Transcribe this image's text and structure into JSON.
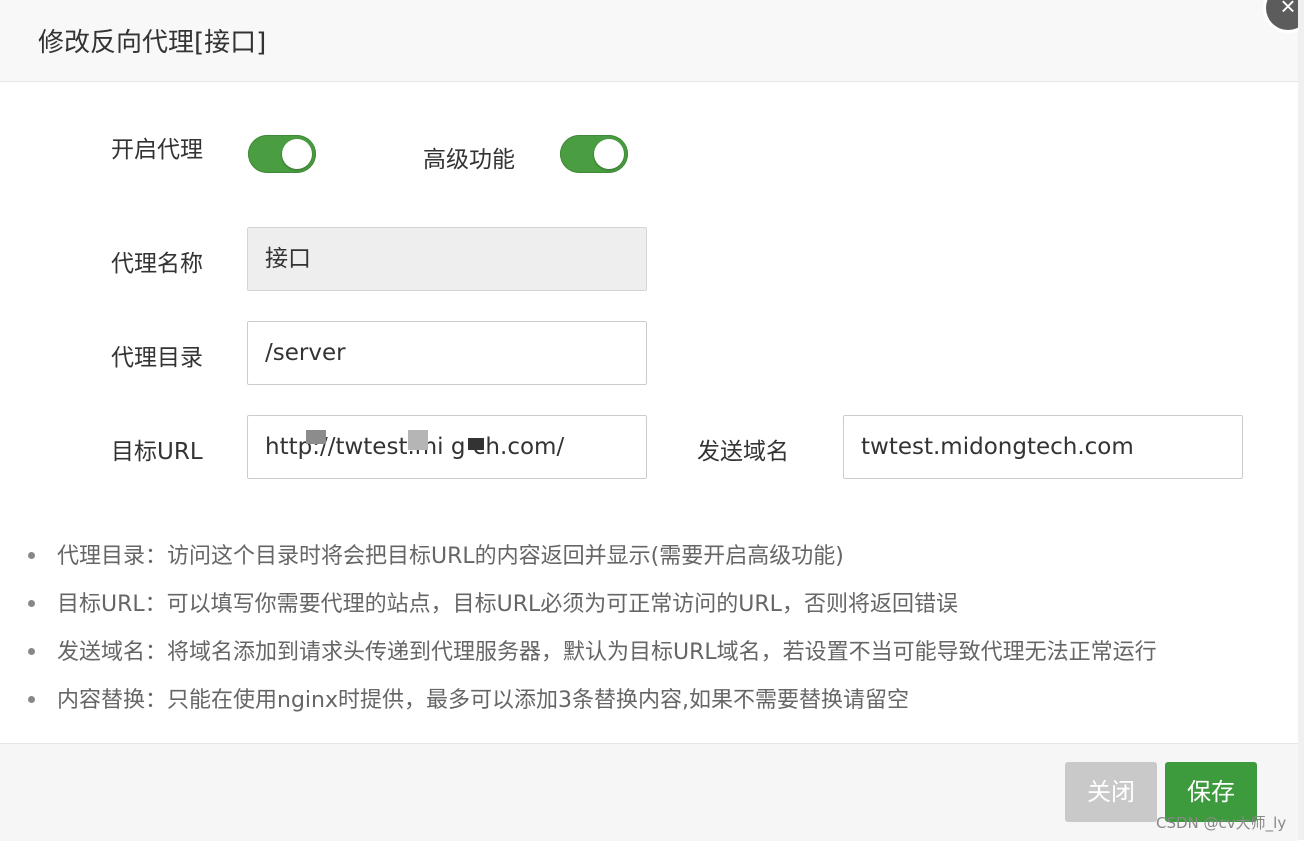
{
  "dialog": {
    "title": "修改反向代理[接口]",
    "close_glyph": "×"
  },
  "form": {
    "enable_proxy": {
      "label": "开启代理",
      "on": true
    },
    "advanced": {
      "label": "高级功能",
      "on": true
    },
    "proxy_name": {
      "label": "代理名称",
      "value": "接口"
    },
    "proxy_dir": {
      "label": "代理目录",
      "value": "/server"
    },
    "target_url": {
      "label": "目标URL",
      "value": "http://twtest.mi  g  ch.com/"
    },
    "send_domain": {
      "label": "发送域名",
      "value": "twtest.midongtech.com"
    }
  },
  "tips": [
    "代理目录：访问这个目录时将会把目标URL的内容返回并显示(需要开启高级功能)",
    "目标URL：可以填写你需要代理的站点，目标URL必须为可正常访问的URL，否则将返回错误",
    "发送域名：将域名添加到请求头传递到代理服务器，默认为目标URL域名，若设置不当可能导致代理无法正常运行",
    "内容替换：只能在使用nginx时提供，最多可以添加3条替换内容,如果不需要替换请留空"
  ],
  "footer": {
    "close_label": "关闭",
    "save_label": "保存"
  },
  "watermark": "CSDN @cv大师_ly",
  "colors": {
    "toggle_on": "#4a9d41",
    "save_button": "#3d9b3d",
    "close_button": "#c9c9c9"
  }
}
